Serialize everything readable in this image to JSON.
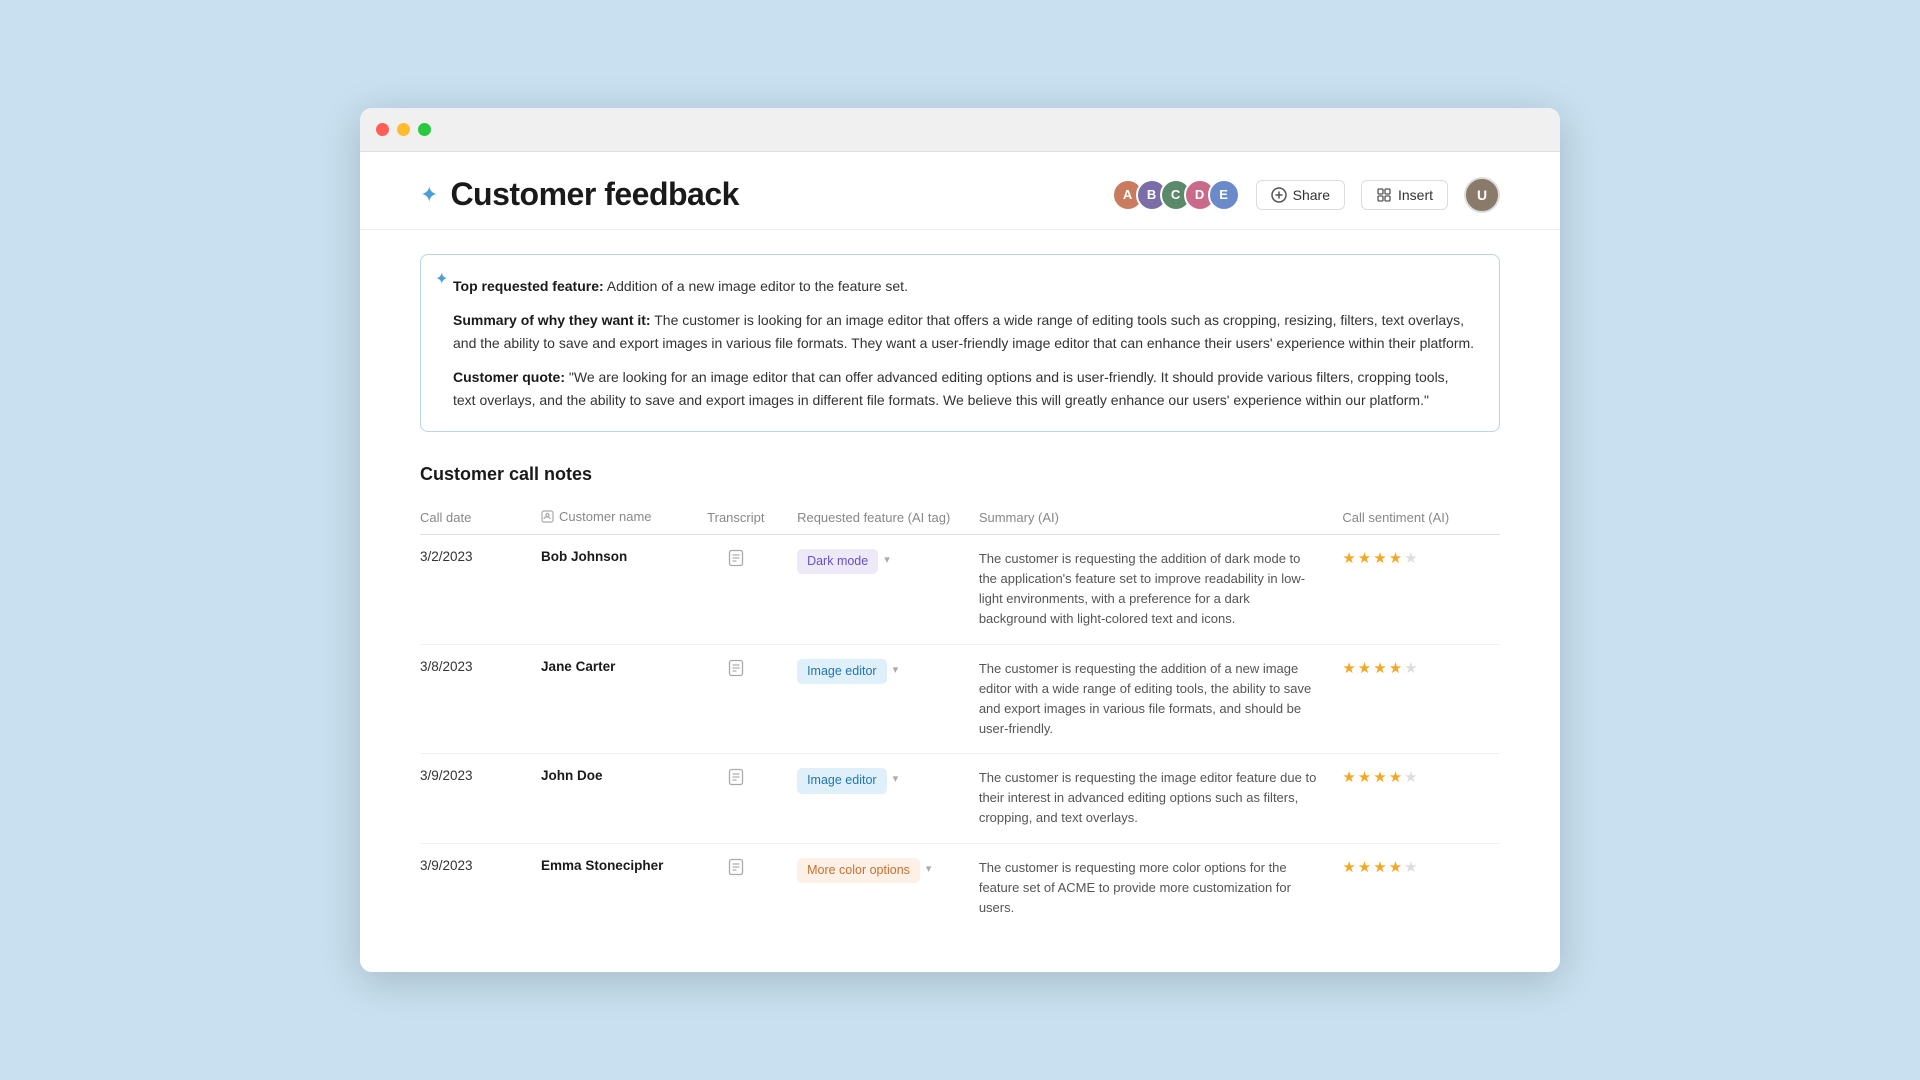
{
  "browser": {
    "traffic_lights": [
      "red",
      "yellow",
      "green"
    ]
  },
  "header": {
    "title": "Customer feedback",
    "share_label": "Share",
    "insert_label": "Insert",
    "avatars": [
      {
        "id": 1,
        "initials": "A",
        "class": "avatar-1"
      },
      {
        "id": 2,
        "initials": "B",
        "class": "avatar-2"
      },
      {
        "id": 3,
        "initials": "C",
        "class": "avatar-3"
      },
      {
        "id": 4,
        "initials": "D",
        "class": "avatar-4"
      },
      {
        "id": 5,
        "initials": "E",
        "class": "avatar-5"
      }
    ]
  },
  "ai_summary": {
    "top_feature_label": "Top requested feature:",
    "top_feature_value": "Addition of a new image editor to the feature set.",
    "summary_label": "Summary of why they want it:",
    "summary_value": "The customer is looking for an image editor that offers a wide range of editing tools such as cropping, resizing, filters, text overlays, and the ability to save and export images in various file formats. They want a user-friendly image editor that can enhance their users' experience within their platform.",
    "quote_label": "Customer quote:",
    "quote_value": "\"We are looking for an image editor that can offer advanced editing options and is user-friendly. It should provide various filters, cropping tools, text overlays, and the ability to save and export images in different file formats. We believe this will greatly enhance our users' experience within our platform.\""
  },
  "table": {
    "section_title": "Customer call notes",
    "columns": [
      {
        "key": "call_date",
        "label": "Call date"
      },
      {
        "key": "customer_name",
        "label": "Customer name"
      },
      {
        "key": "transcript",
        "label": "Transcript"
      },
      {
        "key": "requested_feature",
        "label": "Requested feature (AI tag)"
      },
      {
        "key": "summary",
        "label": "Summary (AI)"
      },
      {
        "key": "sentiment",
        "label": "Call sentiment (AI)"
      }
    ],
    "rows": [
      {
        "call_date": "3/2/2023",
        "customer_name": "Bob Johnson",
        "transcript_icon": "📋",
        "tag_label": "Dark mode",
        "tag_class": "tag-purple",
        "summary": "The customer is requesting the addition of dark mode to the application's feature set to improve readability in low-light environments, with a preference for a dark background with light-colored text and icons.",
        "stars": [
          true,
          true,
          true,
          true,
          false
        ]
      },
      {
        "call_date": "3/8/2023",
        "customer_name": "Jane Carter",
        "transcript_icon": "📋",
        "tag_label": "Image editor",
        "tag_class": "tag-blue",
        "summary": "The customer is requesting the addition of a new image editor with a wide range of editing tools, the ability to save and export images in various file formats, and should be user-friendly.",
        "stars": [
          true,
          true,
          true,
          true,
          false
        ]
      },
      {
        "call_date": "3/9/2023",
        "customer_name": "John Doe",
        "transcript_icon": "📋",
        "tag_label": "Image editor",
        "tag_class": "tag-blue",
        "summary": "The customer is requesting the image editor feature due to their interest in advanced editing options such as filters, cropping, and text overlays.",
        "stars": [
          true,
          true,
          true,
          true,
          false
        ]
      },
      {
        "call_date": "3/9/2023",
        "customer_name": "Emma Stonecipher",
        "transcript_icon": "📋",
        "tag_label": "More color options",
        "tag_class": "tag-orange",
        "summary": "The customer is requesting more color options for the feature set of ACME to provide more customization for users.",
        "stars": [
          true,
          true,
          true,
          true,
          false
        ]
      }
    ]
  }
}
